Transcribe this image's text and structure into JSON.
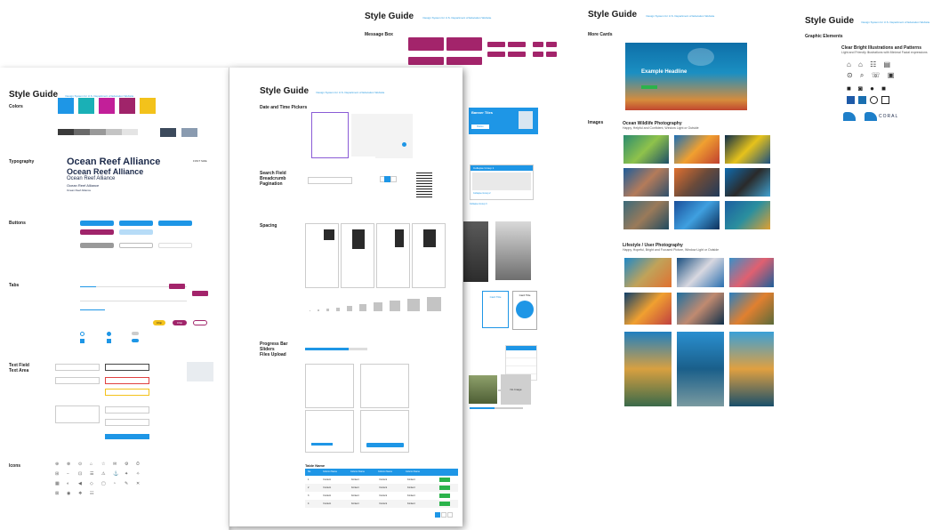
{
  "top_titles": {
    "page2": {
      "title": "Style Guide",
      "subtitle": "Design System for U.S. Department of Education Website"
    },
    "page3": {
      "title": "Style Guide",
      "subtitle": "Design System for U.S. Department of Education Website"
    },
    "page4": {
      "title": "Style Guide",
      "subtitle": "Design System for U.S. Department of Education Website"
    }
  },
  "left": {
    "title": "Style Guide",
    "subtitle": "Design System for U.S. Department of Education Website",
    "sections": {
      "colors": "Colors",
      "typography": "Typography",
      "buttons": "Buttons",
      "tabs": "Tabs",
      "textfield": "Text Field",
      "textarea": "Text Area",
      "icons": "Icons"
    },
    "colors": [
      "#1e96e6",
      "#1ab0b6",
      "#c21f99",
      "#a0246a",
      "#f3c21b"
    ],
    "grays": [
      "#3a3a3a",
      "#6a6a6a",
      "#999999",
      "#c4c4c4",
      "#e4e4e4"
    ],
    "grays2": [
      "#3c4a5c",
      "#8a9bb0"
    ],
    "type_samples": [
      "Ocean Reef Alliance",
      "Ocean Reef Alliance",
      "Ocean Reef Alliance",
      "Ocean Reef Alliance",
      "Ocean Reef Alliance"
    ],
    "font_size_label": "FONT SIZE",
    "chips": {
      "a": "Chip",
      "b": "Chip"
    }
  },
  "mid": {
    "title": "Style Guide",
    "subtitle": "Design System for U.S. Department of Education Website",
    "sections": {
      "date": "Date and Time Pickers",
      "search": "Search Field",
      "breadcrumb": "Breadcrumb",
      "pagination": "Pagination",
      "spacing": "Spacing",
      "progress": "Progress Bar",
      "sliders": "Sliders",
      "files": "Files Upload",
      "table": "Table Name"
    },
    "banner": {
      "title": "Banner Tiles",
      "button": "Button"
    },
    "collapse": {
      "title": "Collapse Group 1",
      "item2": "Collapse Group 2",
      "item3": "Collapse Group 3"
    },
    "table": {
      "headers": [
        "No.",
        "Column Name",
        "Column Name",
        "Column Name",
        "Column Name",
        ""
      ],
      "rows": [
        [
          "1",
          "Content",
          "Content",
          "Content",
          "Content"
        ],
        [
          "2",
          "Content",
          "Content",
          "Content",
          "Content"
        ],
        [
          "3",
          "Content",
          "Content",
          "Content",
          "Content"
        ],
        [
          "4",
          "Content",
          "Content",
          "Content",
          "Content"
        ]
      ]
    },
    "card_titles": [
      "Card Title",
      "Card Title"
    ],
    "no_image": "No Image"
  },
  "message_box": {
    "label": "Message Box"
  },
  "cards_page": {
    "more_cards": "More Cards",
    "headline": "Example Headline",
    "images_label": "Images",
    "wildlife_title": "Ocean Wildlife Photography",
    "wildlife_sub": "Happy, Helpful and Confident, Window Light or Outside",
    "lifestyle_title": "Lifestyle / User Photography",
    "lifestyle_sub": "Happy, Hopeful, Bright and Focused Picture, Window Light or Outside"
  },
  "graphic_page": {
    "section": "Graphic Elements",
    "illus_title": "Clear Bright Illustrations and Patterns",
    "illus_sub": "Light and Friendly Illustrations with Minimal Facial expressions",
    "logo_text": "CORAL"
  }
}
